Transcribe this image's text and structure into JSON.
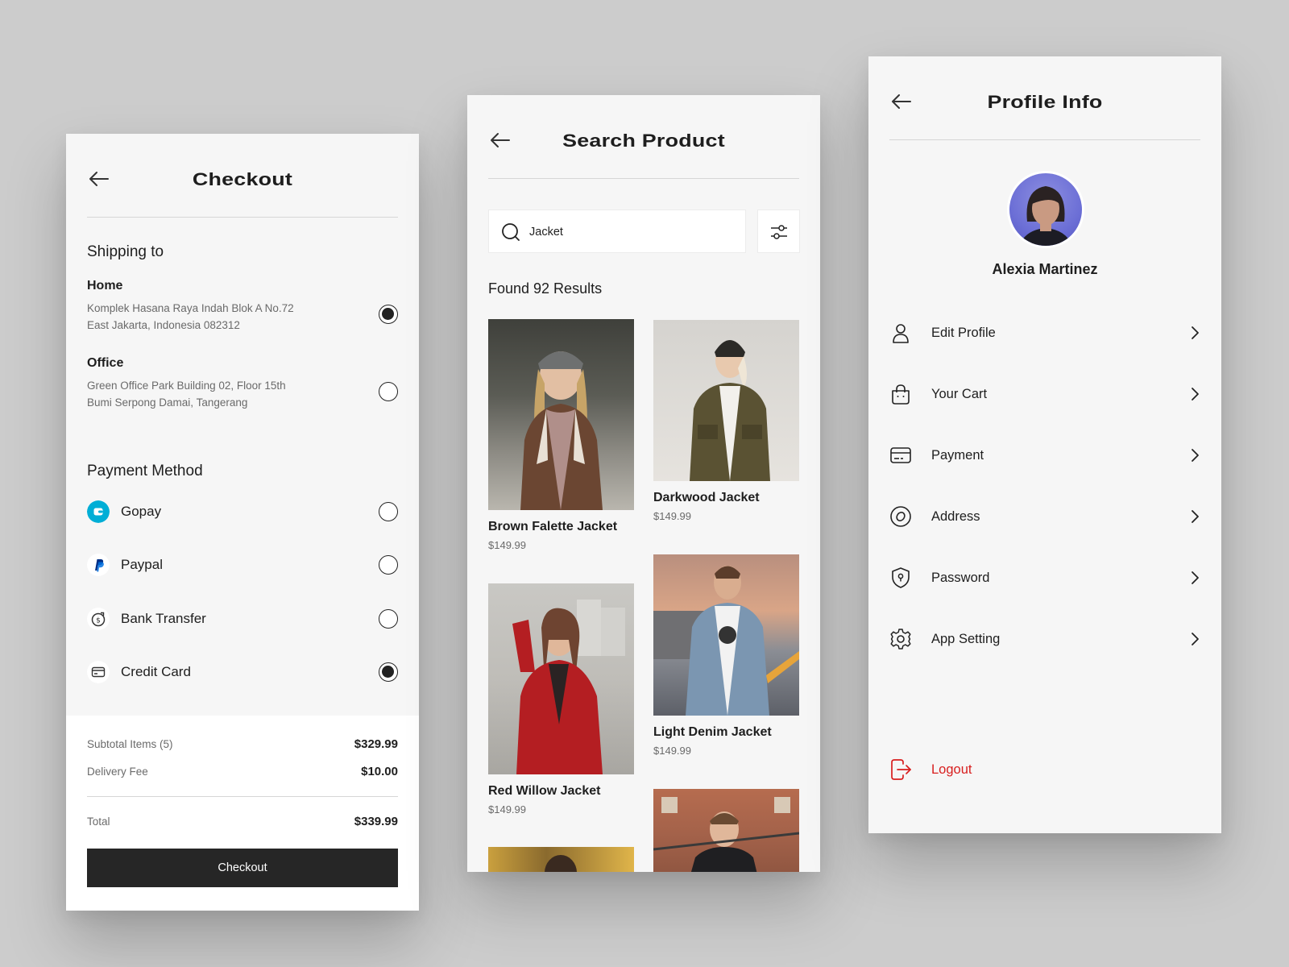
{
  "checkout": {
    "title": "Checkout",
    "shipping_title": "Shipping to",
    "addresses": [
      {
        "name": "Home",
        "line1": "Komplek Hasana Raya Indah Blok A No.72",
        "line2": "East Jakarta, Indonesia 082312",
        "selected": true
      },
      {
        "name": "Office",
        "line1": "Green Office Park Building 02, Floor 15th",
        "line2": "Bumi Serpong Damai, Tangerang",
        "selected": false
      }
    ],
    "payment_title": "Payment Method",
    "payments": [
      {
        "label": "Gopay",
        "icon": "gopay-icon",
        "selected": false
      },
      {
        "label": "Paypal",
        "icon": "paypal-icon",
        "selected": false
      },
      {
        "label": "Bank Transfer",
        "icon": "bank-transfer-icon",
        "selected": false
      },
      {
        "label": "Credit Card",
        "icon": "credit-card-icon",
        "selected": true
      }
    ],
    "summary": {
      "subtotal_label": "Subtotal Items (5)",
      "subtotal_value": "$329.99",
      "delivery_label": "Delivery Fee",
      "delivery_value": "$10.00",
      "total_label": "Total",
      "total_value": "$339.99"
    },
    "button_label": "Checkout"
  },
  "search": {
    "title": "Search Product",
    "query": "Jacket",
    "results_text": "Found 92 Results",
    "products": [
      {
        "name": "Brown Falette Jacket",
        "price": "$149.99"
      },
      {
        "name": "Darkwood Jacket",
        "price": "$149.99"
      },
      {
        "name": "Red Willow Jacket",
        "price": "$149.99"
      },
      {
        "name": "Light Denim Jacket",
        "price": "$149.99"
      }
    ]
  },
  "profile": {
    "title": "Profile Info",
    "user_name": "Alexia Martinez",
    "menu": [
      {
        "label": "Edit Profile",
        "icon": "user-icon"
      },
      {
        "label": "Your Cart",
        "icon": "bag-icon"
      },
      {
        "label": "Payment",
        "icon": "card-icon"
      },
      {
        "label": "Address",
        "icon": "location-icon"
      },
      {
        "label": "Password",
        "icon": "shield-lock-icon"
      },
      {
        "label": "App Setting",
        "icon": "gear-icon"
      }
    ],
    "logout_label": "Logout"
  },
  "colors": {
    "background": "#cccccc",
    "panel": "#f6f6f6",
    "primary_dark": "#262626",
    "logout_red": "#d81e1e",
    "gopay_blue": "#00aed6",
    "paypal_blue": "#003087"
  }
}
